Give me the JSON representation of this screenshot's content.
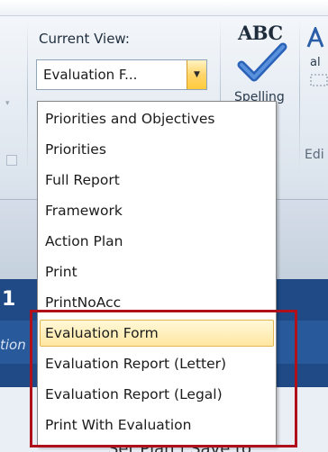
{
  "ribbon": {
    "current_view_label": "Current View:",
    "view_combo": {
      "value": "Evaluation F..."
    },
    "spelling": {
      "abc": "ABC",
      "label": "Spelling"
    },
    "edit_group_label": "Edi",
    "right_partial_text": "al"
  },
  "dropdown": {
    "options": [
      "Priorities and Objectives",
      "Priorities",
      "Full Report",
      "Framework",
      "Action Plan",
      "Print",
      "PrintNoAcc",
      "Evaluation Form",
      "Evaluation Report (Letter)",
      "Evaluation Report (Legal)",
      "Print With Evaluation"
    ],
    "selected": "Evaluation Form"
  },
  "document": {
    "header_fragment": "1",
    "italic_fragment": "tion",
    "bottom_fragment": "Set Plan | Save to"
  },
  "colors": {
    "highlight_box": "#b0101a",
    "selected_item_bg": "#ffe7a1",
    "doc_header": "#1f4a86"
  }
}
